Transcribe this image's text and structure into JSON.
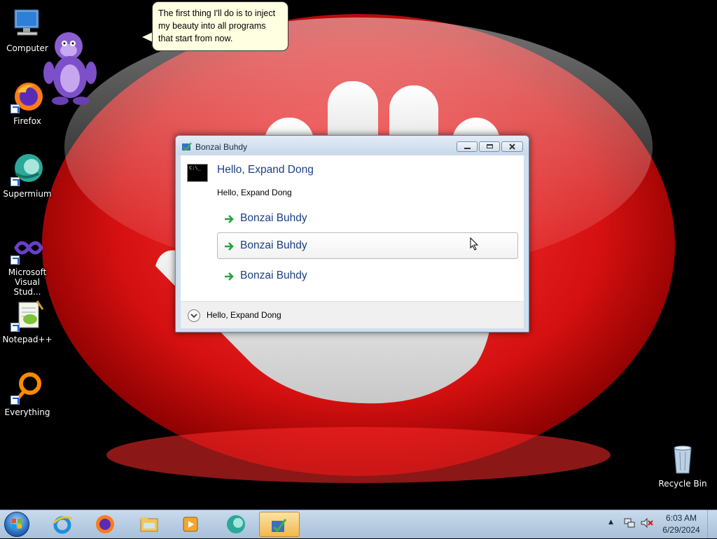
{
  "speech_bubble": {
    "text": "The first thing I'll do is to inject my beauty into all programs that start from now."
  },
  "desktop_icons": [
    {
      "label": "Computer"
    },
    {
      "label": "Firefox"
    },
    {
      "label": "Supermium"
    },
    {
      "label": "Microsoft Visual Stud..."
    },
    {
      "label": "Notepad++"
    },
    {
      "label": "Everything"
    },
    {
      "label": "Recycle Bin"
    }
  ],
  "dialog": {
    "title": "Bonzai Buhdy",
    "main_instruction": "Hello, Expand Dong",
    "content": "Hello, Expand Dong",
    "command_links": [
      {
        "label": "Bonzai Buhdy"
      },
      {
        "label": "Bonzai Buhdy"
      },
      {
        "label": "Bonzai Buhdy"
      }
    ],
    "footer": "Hello, Expand Dong",
    "cmd_icon_text": "C:\\_"
  },
  "taskbar": {
    "clock_time": "6:03 AM",
    "clock_date": "6/29/2024"
  },
  "colors": {
    "accent": "#1b3f84",
    "wallpaper_red": "#e01818"
  }
}
